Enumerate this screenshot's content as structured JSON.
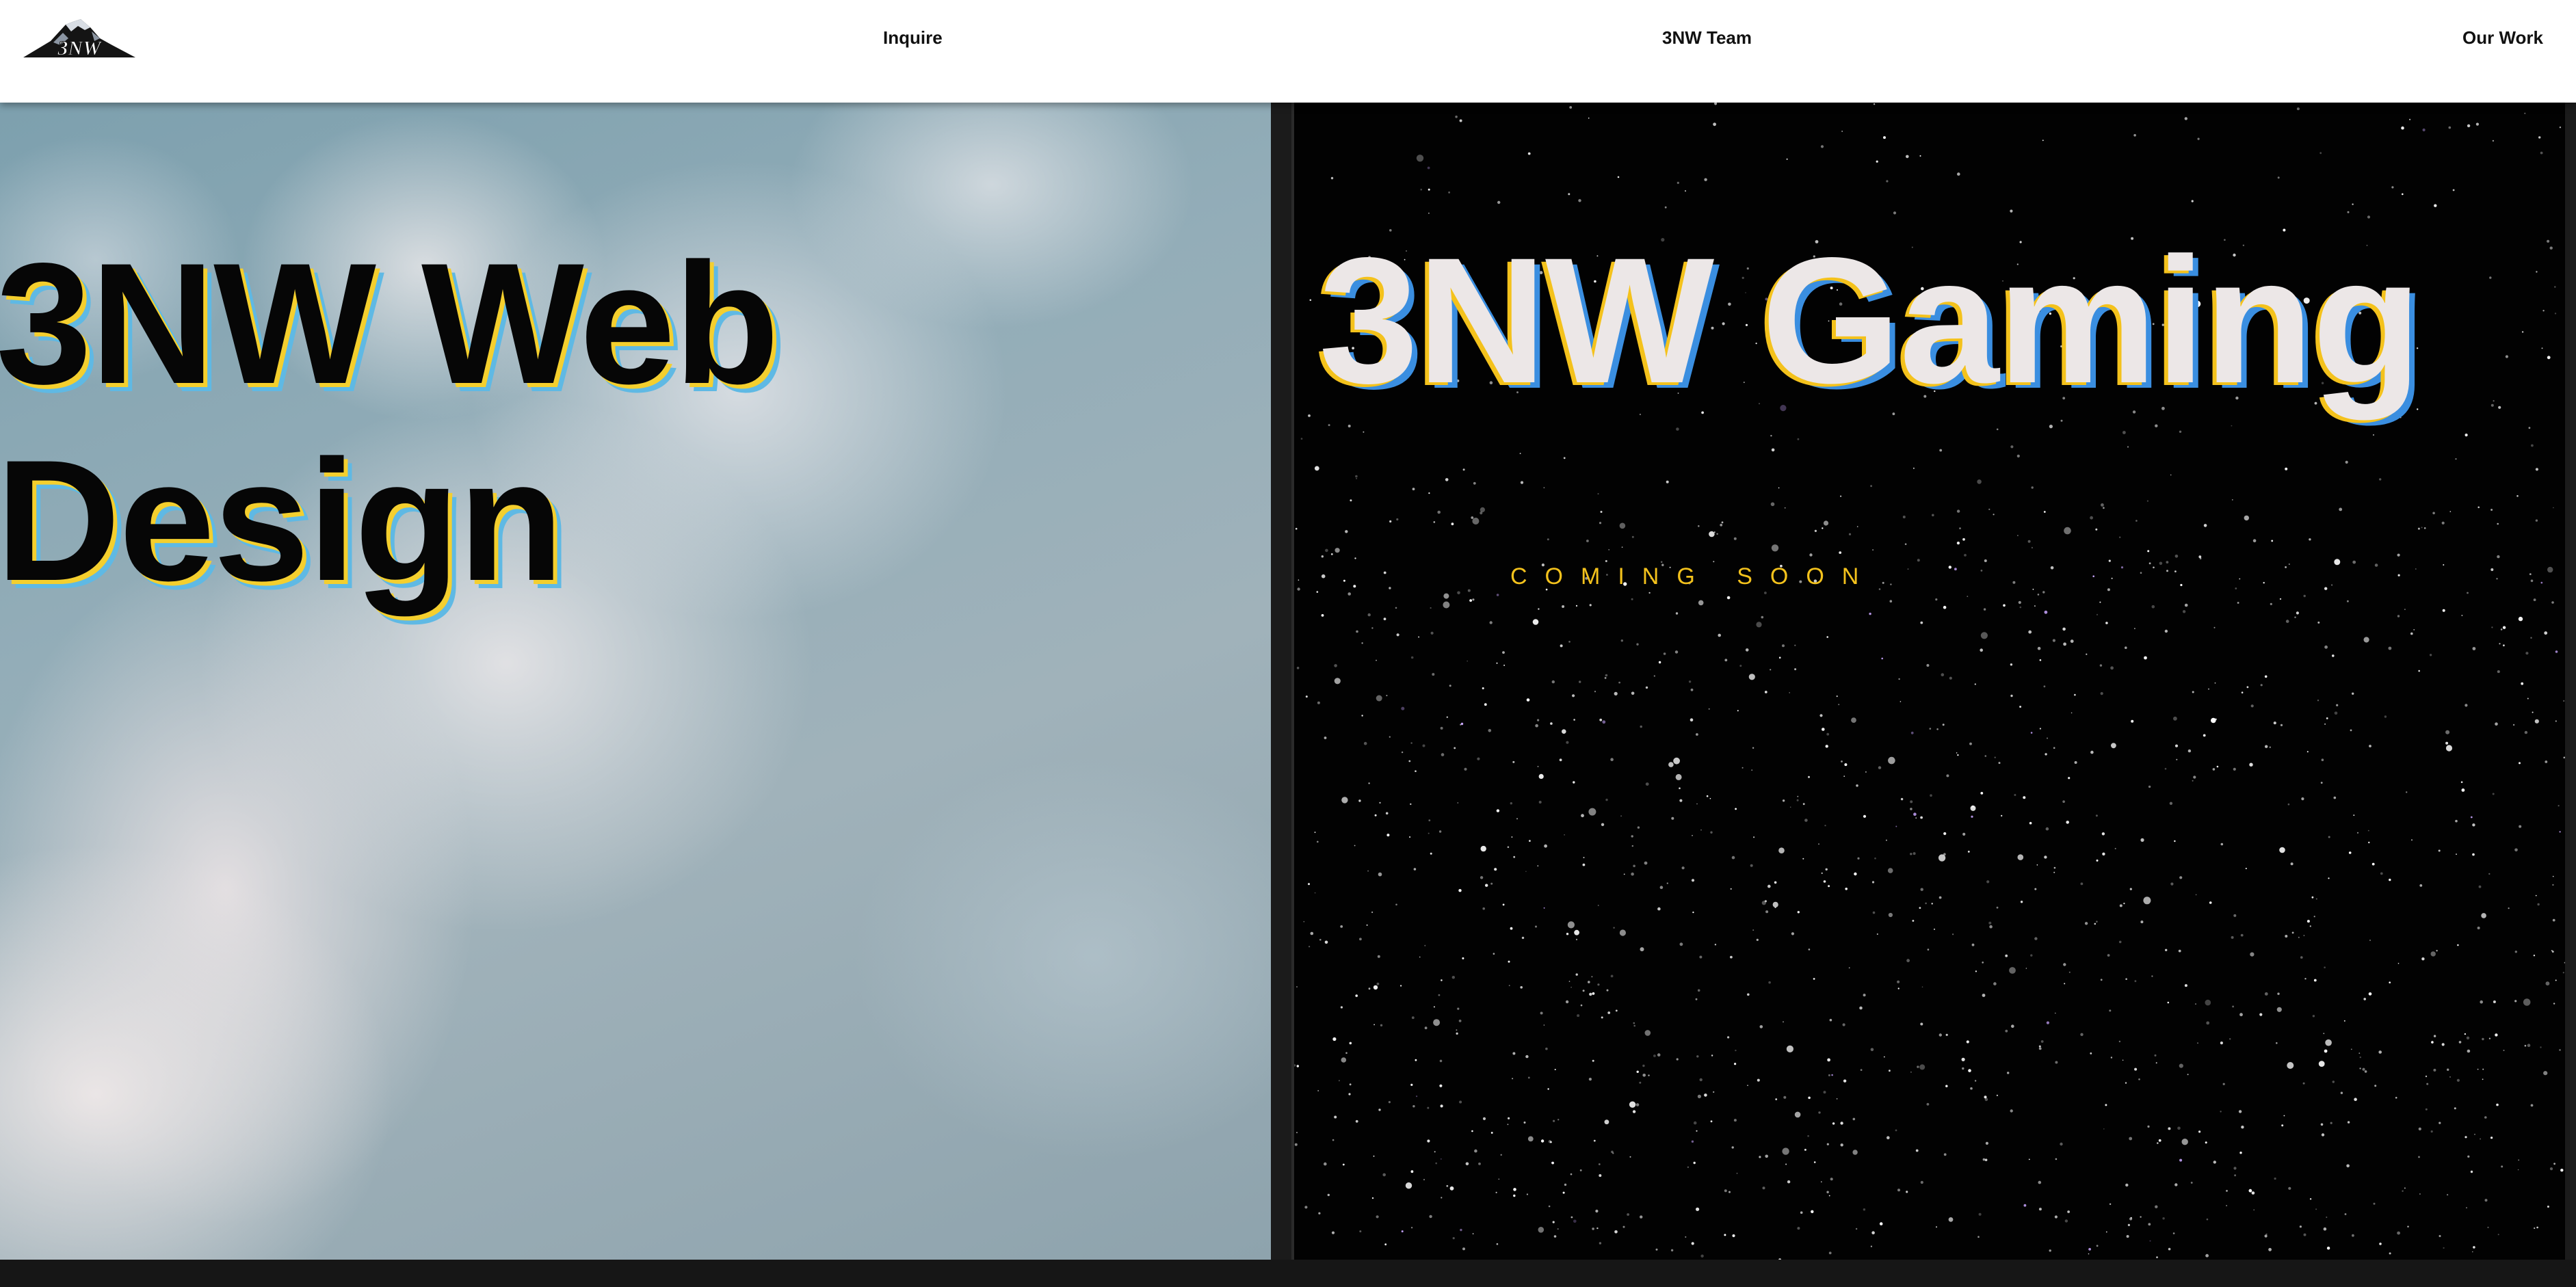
{
  "header": {
    "logo_text": "3NW",
    "nav": {
      "inquire": "Inquire",
      "team": "3NW Team",
      "work": "Our Work"
    }
  },
  "panels": {
    "web": {
      "title_line1": "3NW Web",
      "title_line2": "Design",
      "background": "sky-with-clouds"
    },
    "gaming": {
      "title": "3NW Gaming",
      "subtitle": "COMING SOON",
      "background": "starfield"
    }
  },
  "colors": {
    "header_bg": "#ffffff",
    "accent_yellow": "#f4c21c",
    "accent_blue": "#3a8ee0",
    "web_title": "#060606",
    "gaming_title": "#ece7e7",
    "gaming_bg": "#020202"
  }
}
